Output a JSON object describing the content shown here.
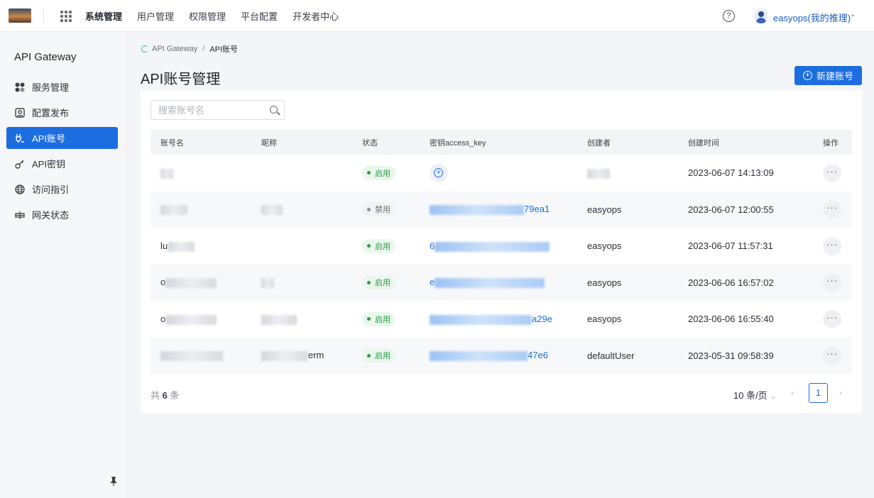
{
  "topbar": {
    "nav": [
      "系统管理",
      "用户管理",
      "权限管理",
      "平台配置",
      "开发者中心"
    ],
    "active_index": 0,
    "help": "?",
    "user": "easyops(我的推理)"
  },
  "sidebar": {
    "title": "API Gateway",
    "items": [
      {
        "label": "服务管理",
        "icon": "service-icon"
      },
      {
        "label": "配置发布",
        "icon": "publish-icon"
      },
      {
        "label": "API账号",
        "icon": "account-icon",
        "active": true
      },
      {
        "label": "API密钥",
        "icon": "key-icon"
      },
      {
        "label": "访问指引",
        "icon": "globe-icon"
      },
      {
        "label": "网关状态",
        "icon": "gateway-icon"
      }
    ]
  },
  "breadcrumb": {
    "root": "API Gateway",
    "separator": "/",
    "current": "API账号"
  },
  "page": {
    "title": "API账号管理",
    "new_button": "新建账号",
    "search_placeholder": "搜索账号名"
  },
  "table": {
    "columns": [
      "账号名",
      "昵称",
      "状态",
      "密钥access_key",
      "创建者",
      "创建时间",
      "操作"
    ],
    "rows": [
      {
        "name": "",
        "nickname": "",
        "status": "启用",
        "status_on": true,
        "access_key": "",
        "creator": "",
        "created": "2023-06-07 14:13:09",
        "more": "···"
      },
      {
        "name": "",
        "nickname": "",
        "status": "禁用",
        "status_on": false,
        "access_key": "79ea1",
        "creator": "easyops",
        "created": "2023-06-07 12:00:55",
        "more": "···"
      },
      {
        "name": "lu",
        "nickname": "",
        "status": "启用",
        "status_on": true,
        "access_key": "6",
        "creator": "easyops",
        "created": "2023-06-07 11:57:31",
        "more": "···"
      },
      {
        "name": "o",
        "nickname": "",
        "status": "启用",
        "status_on": true,
        "access_key": "e",
        "creator": "easyops",
        "created": "2023-06-06 16:57:02",
        "more": "···"
      },
      {
        "name": "o",
        "nickname": "",
        "status": "启用",
        "status_on": true,
        "access_key": "a29e",
        "creator": "easyops",
        "created": "2023-06-06 16:55:40",
        "more": "···"
      },
      {
        "name": "",
        "nickname": "erm",
        "status": "启用",
        "status_on": true,
        "access_key": "47e6",
        "creator": "defaultUser",
        "created": "2023-05-31 09:58:39",
        "more": "···"
      }
    ]
  },
  "pagination": {
    "total_prefix": "共",
    "total": "6",
    "total_suffix": "条",
    "page_size": "10 条/页",
    "current_page": "1",
    "prev": "‹",
    "next": "›"
  },
  "colors": {
    "primary": "#1c6de0",
    "enabled": "#2a9c48"
  }
}
